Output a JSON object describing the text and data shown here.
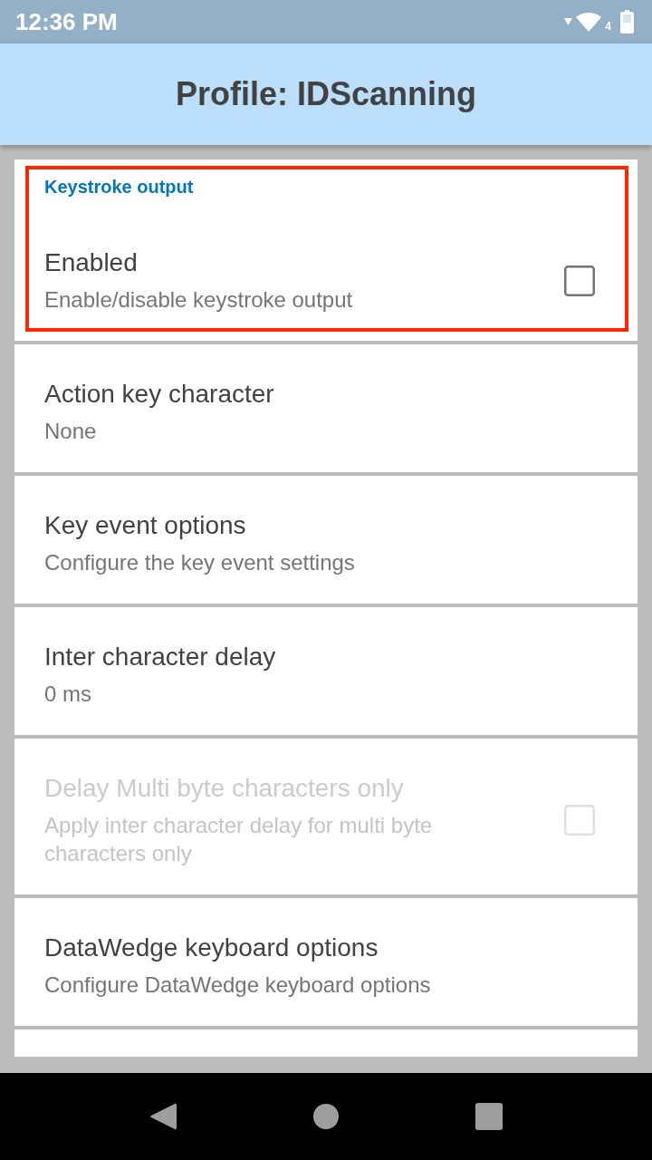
{
  "status_bar": {
    "time": "12:36 PM",
    "network_type": "4"
  },
  "app_bar": {
    "title": "Profile: IDScanning"
  },
  "preferences": [
    {
      "kind": "checkbox",
      "category": "Keystroke output",
      "highlighted": true,
      "title": "Enabled",
      "summary": "Enable/disable keystroke output",
      "checked": false,
      "disabled": false
    },
    {
      "kind": "text",
      "highlighted": false,
      "title": "Action key character",
      "summary": "None",
      "disabled": false
    },
    {
      "kind": "text",
      "highlighted": false,
      "title": "Key event options",
      "summary": "Configure the key event settings",
      "disabled": false
    },
    {
      "kind": "text",
      "highlighted": false,
      "title": "Inter character delay",
      "summary": "0 ms",
      "disabled": false
    },
    {
      "kind": "checkbox",
      "highlighted": false,
      "title": "Delay Multi byte characters only",
      "summary": "Apply inter character delay for multi byte characters only",
      "checked": false,
      "disabled": true
    },
    {
      "kind": "text",
      "highlighted": false,
      "title": "DataWedge keyboard options",
      "summary": "Configure DataWedge keyboard options",
      "disabled": false
    },
    {
      "kind": "cut_off"
    }
  ]
}
